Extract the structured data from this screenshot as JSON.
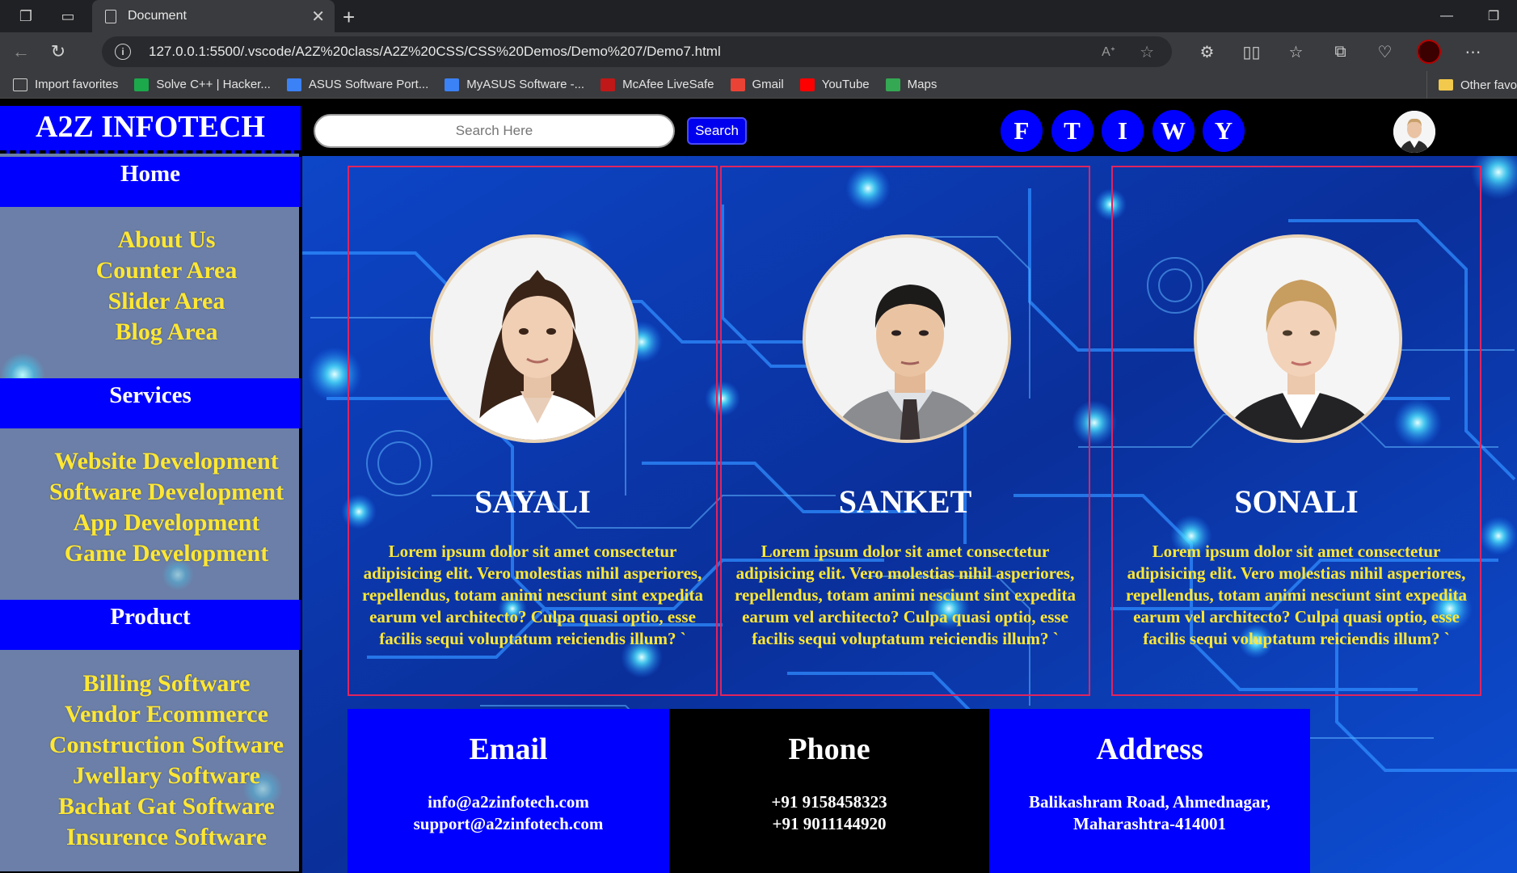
{
  "browser": {
    "tab_title": "Document",
    "url": "127.0.0.1:5500/.vscode/A2Z%20class/A2Z%20CSS/CSS%20Demos/Demo%207/Demo7.html",
    "bookmarks": [
      {
        "label": "Import favorites",
        "icon": "import-icon",
        "color": "#cfcfcf"
      },
      {
        "label": "Solve C++ | Hacker...",
        "icon": "hackerrank-icon",
        "color": "#1ba94c"
      },
      {
        "label": "ASUS Software Port...",
        "icon": "asus-icon",
        "color": "#3b82f6"
      },
      {
        "label": "MyASUS Software -...",
        "icon": "myasus-icon",
        "color": "#3b82f6"
      },
      {
        "label": "McAfee LiveSafe",
        "icon": "mcafee-icon",
        "color": "#c01818"
      },
      {
        "label": "Gmail",
        "icon": "gmail-icon",
        "color": "#ea4335"
      },
      {
        "label": "YouTube",
        "icon": "youtube-icon",
        "color": "#ff0000"
      },
      {
        "label": "Maps",
        "icon": "maps-icon",
        "color": "#34a853"
      }
    ],
    "other_favorites": "Other favo"
  },
  "sidebar": {
    "brand": "A2Z INFOTECH",
    "sections": [
      {
        "title": "Home",
        "items": [
          "About Us",
          "Counter Area",
          "Slider Area",
          "Blog Area"
        ]
      },
      {
        "title": "Services",
        "items": [
          "Website Development",
          "Software Development",
          "App Development",
          "Game Development"
        ]
      },
      {
        "title": "Product",
        "items": [
          "Billing Software",
          "Vendor Ecommerce",
          "Construction Software",
          "Jwellary Software",
          "Bachat Gat Software",
          "Insurence Software"
        ]
      }
    ]
  },
  "header": {
    "search_placeholder": "Search Here",
    "search_button": "Search",
    "socials": [
      "F",
      "T",
      "I",
      "W",
      "Y"
    ]
  },
  "team": [
    {
      "name": "SAYALI",
      "description": "Lorem ipsum dolor sit amet consectetur adipisicing elit. Vero molestias nihil asperiores, repellendus, totam animi nesciunt sint expedita earum vel architecto? Culpa quasi optio, esse facilis sequi voluptatum reiciendis illum? `"
    },
    {
      "name": "SANKET",
      "description": "Lorem ipsum dolor sit amet consectetur adipisicing elit. Vero molestias nihil asperiores, repellendus, totam animi nesciunt sint expedita earum vel architecto? Culpa quasi optio, esse facilis sequi voluptatum reiciendis illum? `"
    },
    {
      "name": "SONALI",
      "description": "Lorem ipsum dolor sit amet consectetur adipisicing elit. Vero molestias nihil asperiores, repellendus, totam animi nesciunt sint expedita earum vel architecto? Culpa quasi optio, esse facilis sequi voluptatum reiciendis illum? `"
    }
  ],
  "contact": {
    "email": {
      "title": "Email",
      "lines": [
        "info@a2zinfotech.com",
        "support@a2zinfotech.com"
      ]
    },
    "phone": {
      "title": "Phone",
      "lines": [
        "+91 9158458323",
        "+91 9011144920"
      ]
    },
    "address": {
      "title": "Address",
      "lines": [
        "Balikashram Road, Ahmednagar,",
        "Maharashtra-414001"
      ]
    }
  },
  "colors": {
    "brand_blue": "#0000ff",
    "accent_yellow": "#ffe733",
    "card_border": "#e0245e",
    "sidebar_bg": "#6b7fa8"
  }
}
